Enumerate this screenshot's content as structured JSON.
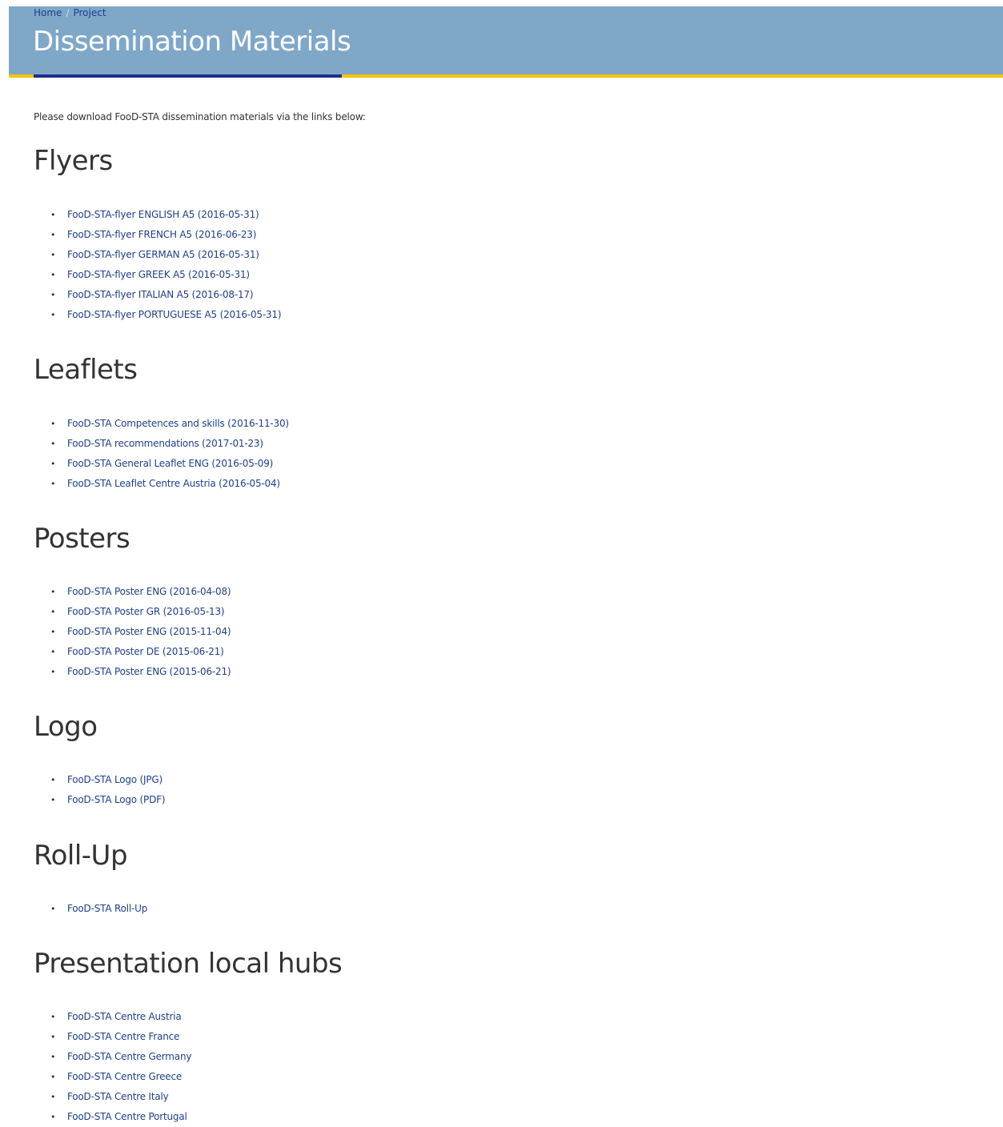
{
  "header": {
    "breadcrumb": {
      "home": "Home",
      "separator": "/",
      "current": "Project"
    },
    "title": "Dissemination Materials",
    "colors": {
      "banner": "#7fa7c8",
      "accent_blue": "#1e2f8c",
      "accent_yellow": "#f2c500",
      "link": "#1f3f8a"
    }
  },
  "intro": "Please download FooD-STA dissemination materials via the links below:",
  "sections": {
    "flyers": {
      "heading": "Flyers",
      "items": [
        "FooD-STA-flyer ENGLISH A5 (2016-05-31)",
        "FooD-STA-flyer FRENCH A5 (2016-06-23)",
        "FooD-STA-flyer GERMAN A5 (2016-05-31)",
        "FooD-STA-flyer GREEK A5 (2016-05-31)",
        "FooD-STA-flyer ITALIAN A5 (2016-08-17)",
        "FooD-STA-flyer PORTUGUESE A5 (2016-05-31)"
      ]
    },
    "leaflets": {
      "heading": "Leaflets",
      "items": [
        "FooD-STA Competences and skills (2016-11-30)",
        "FooD-STA recommendations (2017-01-23)",
        "FooD-STA General Leaflet ENG (2016-05-09)",
        "FooD-STA Leaflet Centre Austria (2016-05-04)"
      ]
    },
    "posters": {
      "heading": "Posters",
      "items": [
        "FooD-STA Poster ENG (2016-04-08)",
        "FooD-STA Poster GR (2016-05-13)",
        "FooD-STA Poster ENG (2015-11-04)",
        "FooD-STA Poster DE (2015-06-21)",
        "FooD-STA Poster ENG (2015-06-21)"
      ]
    },
    "logo": {
      "heading": "Logo",
      "items": [
        "FooD-STA Logo (JPG)",
        "FooD-STA Logo (PDF)"
      ]
    },
    "rollup": {
      "heading": "Roll-Up",
      "items": [
        "FooD-STA Roll-Up"
      ]
    },
    "hubs": {
      "heading": "Presentation local hubs",
      "items": [
        "FooD-STA Centre Austria",
        "FooD-STA Centre France",
        "FooD-STA Centre Germany",
        "FooD-STA Centre Greece",
        "FooD-STA Centre Italy",
        "FooD-STA Centre Portugal"
      ]
    }
  }
}
